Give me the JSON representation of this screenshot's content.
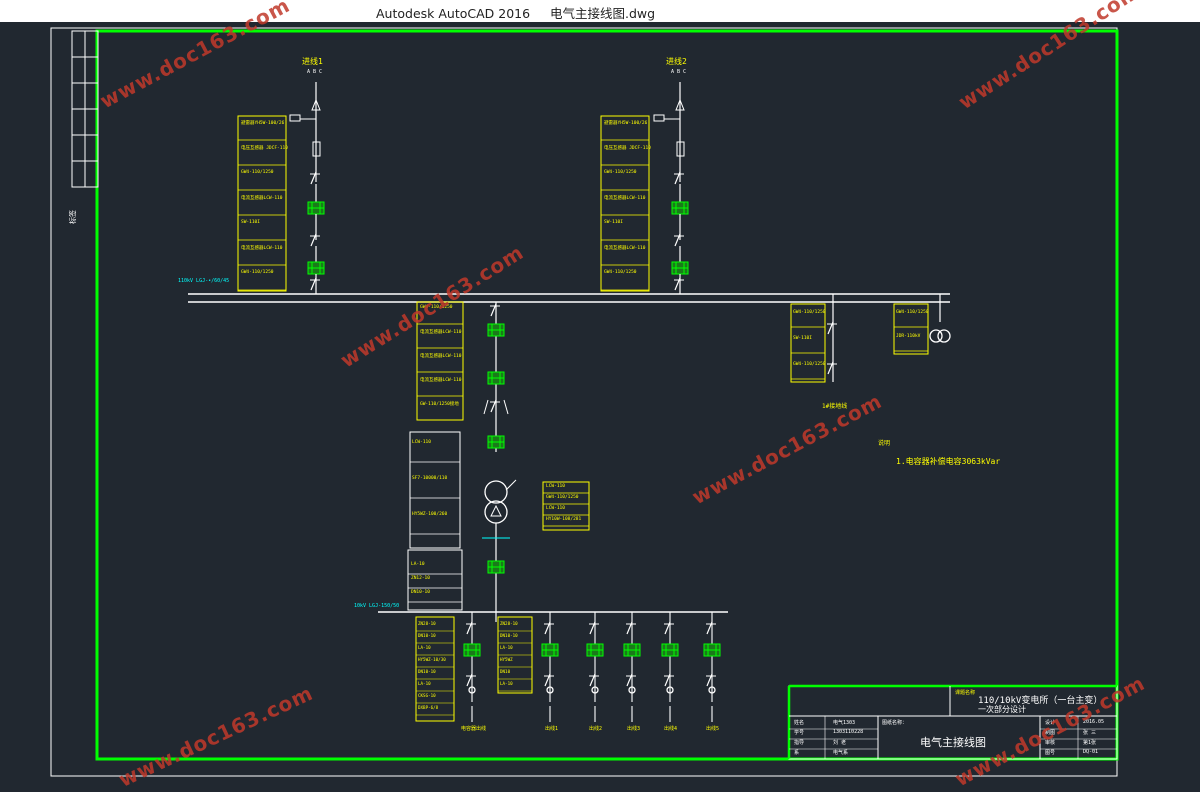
{
  "window": {
    "app_title": "Autodesk AutoCAD 2016",
    "file_name": "电气主接线图.dwg"
  },
  "drawing": {
    "incoming_1": "进线1",
    "incoming_2": "进线2",
    "phases": "A B C",
    "bus_110": "110kV LGJ-•/60/45",
    "bus_10": "10kV LGJ-150/50",
    "ground_switch": "1#接地线",
    "note_title": "说明",
    "note_text": "1.电容器补偿电容3063kVar",
    "panel_1": [
      "避雷器YH5W-100/260",
      "电压互感器 JDCF-110",
      "GW4-110/1250",
      "电流互感器LCW-110",
      "SW-110I",
      "电流互感器LCW-110",
      "GW4-110/1250"
    ],
    "panel_2": [
      "避雷器YH5W-100/260",
      "电压互感器 JDCF-110",
      "GW4-110/1250",
      "电流互感器LCW-110",
      "SW-110I",
      "电流互感器LCW-110",
      "GW4-110/1250"
    ],
    "panel_tx_hv": [
      "GW4-110/1250",
      "电流互感器LCW-110",
      "电流互感器LCW-110",
      "电流互感器LCW-110",
      "GW-110/1250接地"
    ],
    "panel_tx_side": [
      "LCW-110",
      "SF7-10000/110",
      "HY5WZ-100/260"
    ],
    "panel_tx_right": [
      "LCW-110",
      "GW4-110/1250",
      "LCW-110",
      "HY10W-108/281"
    ],
    "panel_tx_lv": [
      "LA-10",
      "ZN12-10",
      "DN10-10"
    ],
    "panel_pt": [
      "GW4-110/1250",
      "SW-110I",
      "GW4-110/1250"
    ],
    "panel_arrester": [
      "GW4-110/1250",
      "JDR-110kV"
    ],
    "panel_feed_1": [
      "ZN28-10",
      "DN10-10",
      "LA-10",
      "HY5WZ-10/30",
      "DN10-10",
      "LA-10",
      "CKSG-10",
      "DXBP-6/8"
    ],
    "panel_feed_2": [
      "ZN28-10",
      "DN10-10",
      "LA-10",
      "HY5WZ",
      "DN10",
      "LA-10"
    ],
    "feeders": [
      "出线1",
      "出线2",
      "出线3",
      "出线4",
      "出线5"
    ],
    "left_feeder": "电容器出线",
    "left_strip": "标签",
    "title_block": {
      "school_label": "课题名称",
      "title": "110/10kV变电所（一台主变）",
      "subtitle": "一次部分设计",
      "drawing_name_label": "图纸名称：",
      "drawing_name": "电气主接线图",
      "rows": [
        [
          "姓名",
          "电气1303",
          "设计",
          "2016.05"
        ],
        [
          "学号",
          "1303110228",
          "制图",
          "张 三"
        ],
        [
          "指导",
          "刘 老",
          "审核",
          "第1张"
        ],
        [
          "系",
          "电气系",
          "图号",
          "DQ-01"
        ]
      ]
    }
  },
  "watermark": "www.doc163.com",
  "colors": {
    "background": "#212830",
    "border": "#00ff00",
    "text": "#ffff00",
    "line": "#ffffff",
    "switch": "#00ff00",
    "cyan": "#00ffff"
  }
}
